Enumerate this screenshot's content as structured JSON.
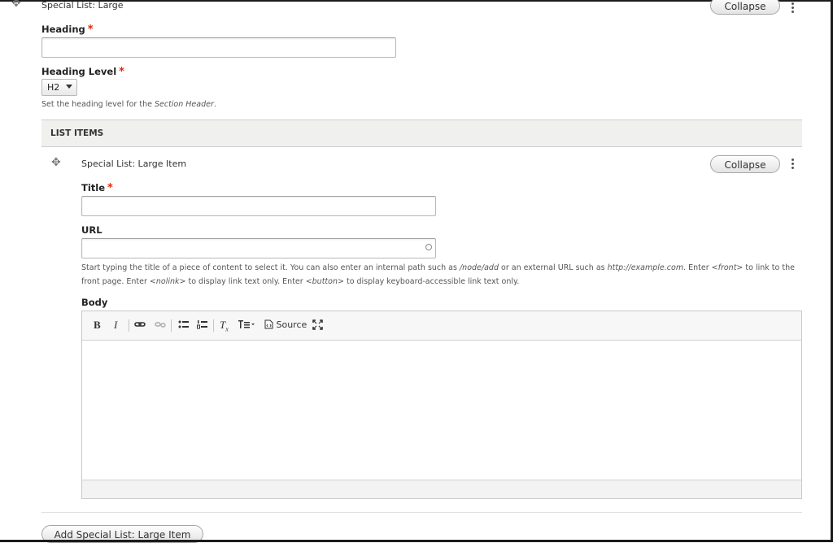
{
  "paragraph": {
    "title": "Special List: Large",
    "collapse_label": "Collapse",
    "heading_label": "Heading",
    "heading_value": "",
    "heading_level_label": "Heading Level",
    "heading_level_value": "H2",
    "heading_level_desc_prefix": "Set the heading level for the ",
    "heading_level_desc_em": "Section Header",
    "heading_level_desc_suffix": "."
  },
  "list_items": {
    "header": "LIST ITEMS",
    "add_button": "Add Special List: Large Item"
  },
  "item": {
    "title": "Special List: Large Item",
    "collapse_label": "Collapse",
    "title_label": "Title",
    "title_value": "",
    "url_label": "URL",
    "url_value": "",
    "url_desc": {
      "p1": "Start typing the title of a piece of content to select it. You can also enter an internal path such as ",
      "em1": "/node/add",
      "p2": " or an external URL such as ",
      "em2": "http://example.com",
      "p3": ". Enter ",
      "em3": "<front>",
      "p4": " to link to the front page. Enter ",
      "em4": "<nolink>",
      "p5": " to display link text only. Enter ",
      "em5": "<button>",
      "p6": " to display keyboard-accessible link text only."
    },
    "body_label": "Body",
    "toolbar": {
      "bold": "B",
      "italic": "I",
      "link_icon": "link-icon",
      "unlink_icon": "unlink-icon",
      "bullet_icon": "bulleted-list-icon",
      "numbered_icon": "numbered-list-icon",
      "clear_format_icon": "remove-format-icon",
      "styles_icon": "styles-dropdown-icon",
      "source_label": "Source",
      "maximize_icon": "maximize-icon"
    }
  },
  "required_marker": "*"
}
